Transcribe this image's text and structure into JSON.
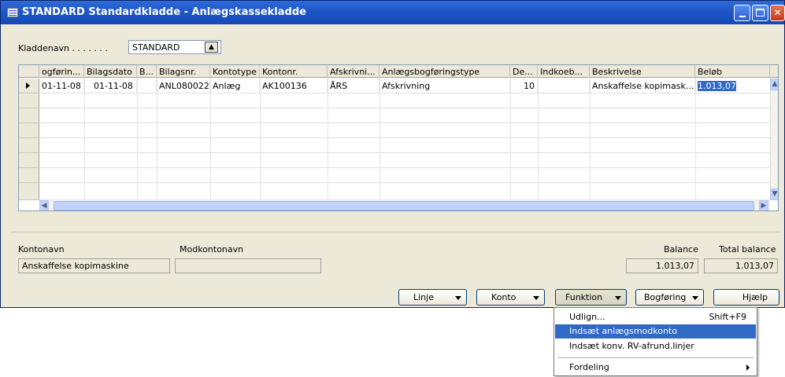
{
  "window": {
    "title": "STANDARD Standardkladde - Anlægskassekladde",
    "icon": "journal-icon"
  },
  "kladdenavn": {
    "label": "Kladdenavn . . . . . . .",
    "value": "STANDARD"
  },
  "grid": {
    "columns": [
      "ogførin...",
      "Bilagsdato",
      "B...",
      "Bilagsnr.",
      "Kontotype",
      "Kontonr.",
      "Afskrivni...",
      "Anlægsbogføringstype",
      "De...",
      "Indkoeb...",
      "Beskrivelse",
      "Beløb"
    ],
    "rows": [
      {
        "bogforingsdato": "01-11-08",
        "bilagsdato": "01-11-08",
        "b": "",
        "bilagsnr": "ANL080022",
        "kontotype": "Anlæg",
        "kontonr": "AK100136",
        "afskrivning": "ÅRS",
        "type": "Afskrivning",
        "de": "10",
        "indkoeb": "",
        "beskrivelse": "Anskaffelse kopimask...",
        "belob": "1.013,07"
      }
    ]
  },
  "footer": {
    "kontonavn_label": "Kontonavn",
    "kontonavn_value": "Anskaffelse kopimaskine",
    "modkontonavn_label": "Modkontonavn",
    "modkontonavn_value": "",
    "balance_label": "Balance",
    "balance_value": "1.013,07",
    "total_balance_label": "Total balance",
    "total_balance_value": "1.013,07"
  },
  "buttons": {
    "linje": "Linje",
    "konto": "Konto",
    "funktion": "Funktion",
    "bogforing": "Bogføring",
    "hjaelp": "Hjælp"
  },
  "menu": {
    "items": [
      {
        "label": "Udlign...",
        "shortcut": "Shift+F9"
      },
      {
        "label": "Indsæt anlægsmodkonto",
        "shortcut": ""
      },
      {
        "label": "Indsæt konv. RV-afrund.linjer",
        "shortcut": ""
      },
      {
        "label": "Fordeling",
        "shortcut": ""
      }
    ]
  }
}
